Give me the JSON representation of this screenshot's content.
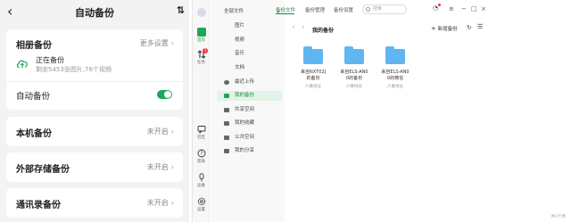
{
  "phone": {
    "back_icon": "‹",
    "title": "自动备份",
    "sort_icon": "⇅",
    "album": {
      "title": "相册备份",
      "more": "更多设置",
      "status_title": "正在备份",
      "status_detail": "剩余5453张图片,76个视频"
    },
    "auto_backup_label": "自动备份",
    "auto_backup_on": true,
    "rows": [
      {
        "title": "本机备份",
        "value": "未开启"
      },
      {
        "title": "外部存储备份",
        "value": "未开启"
      },
      {
        "title": "通讯录备份",
        "value": "未开启"
      }
    ],
    "accent_color": "#1fa558"
  },
  "desktop": {
    "rail": [
      {
        "label": "",
        "icon": "avatar-icon"
      },
      {
        "label": "首页",
        "icon": "home-icon"
      },
      {
        "label": "任务",
        "icon": "transfer-icon",
        "badge": "5"
      },
      {
        "label": "社区",
        "icon": "chat-icon"
      },
      {
        "label": "帮助",
        "icon": "help-icon"
      },
      {
        "label": "设备",
        "icon": "device-icon"
      },
      {
        "label": "设置",
        "icon": "settings-icon"
      }
    ],
    "tree": [
      {
        "label": "全部文件",
        "sub": false
      },
      {
        "label": "图片",
        "sub": true
      },
      {
        "label": "视频",
        "sub": true
      },
      {
        "label": "音乐",
        "sub": true
      },
      {
        "label": "文档",
        "sub": true
      },
      {
        "label": "最近上传",
        "sub": false
      },
      {
        "label": "我的备份",
        "sub": false,
        "active": true
      },
      {
        "label": "共享空间",
        "sub": false
      },
      {
        "label": "我的收藏",
        "sub": false
      },
      {
        "label": "公共空间",
        "sub": false
      },
      {
        "label": "我的分享",
        "sub": false
      }
    ],
    "tabs": [
      "备份文件",
      "备份管理",
      "备份设置"
    ],
    "search_placeholder": "搜索",
    "breadcrumb": "我的备份",
    "new_backup": "新增备份",
    "folders": [
      {
        "name_line1": "来自NXT02J",
        "name_line2": "的备份",
        "owner": "六重绿豆"
      },
      {
        "name_line1": "来自ELS-AN0",
        "name_line2": "0的备份",
        "owner": "六重绿豆"
      },
      {
        "name_line1": "来自ELS-AN0",
        "name_line2": "0的微信",
        "owner": "六重绿豆"
      }
    ],
    "footer_count": "共3个项",
    "accent_color": "#1a8a4a"
  }
}
